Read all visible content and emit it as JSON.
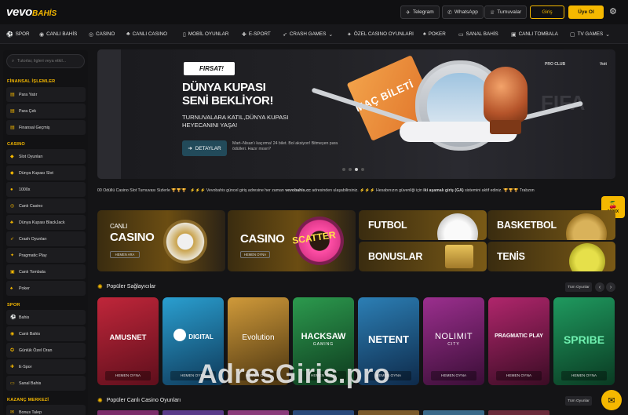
{
  "brand": {
    "name_main": "vevo",
    "name_accent": "BAHİS"
  },
  "topbar": {
    "links": [
      {
        "label": "Telegram",
        "icon": "telegram-icon"
      },
      {
        "label": "WhatsApp",
        "icon": "whatsapp-icon"
      },
      {
        "label": "Turnuvalar",
        "icon": "trophy-icon"
      }
    ],
    "login": "Giriş",
    "register": "Üye Ol"
  },
  "nav": [
    {
      "label": "SPOR",
      "icon": "ball-icon"
    },
    {
      "label": "CANLI BAHİS",
      "icon": "live-icon"
    },
    {
      "label": "CASINO",
      "icon": "chip-icon"
    },
    {
      "label": "CANLI CASINO",
      "icon": "cards-icon"
    },
    {
      "label": "MOBİL OYUNLAR",
      "icon": "mobile-icon"
    },
    {
      "label": "E-SPORT",
      "icon": "gamepad-icon"
    },
    {
      "label": "CRASH GAMES",
      "icon": "rocket-icon"
    },
    {
      "label": "ÖZEL CASINO OYUNLARI",
      "icon": "star-icon"
    },
    {
      "label": "POKER",
      "icon": "spade-icon"
    },
    {
      "label": "SANAL BAHİS",
      "icon": "monitor-icon"
    },
    {
      "label": "CANLI TOMBALA",
      "icon": "ticket-icon"
    },
    {
      "label": "TV GAMES",
      "icon": "tv-icon"
    }
  ],
  "sidebar": {
    "search_placeholder": "Tutorlar, ligleri veya etkil...",
    "sections": [
      {
        "title": "FİNANSAL İŞLEMLER",
        "items": [
          "Para Yatır",
          "Para Çek",
          "Finansal Geçmiş"
        ]
      },
      {
        "title": "CASINO",
        "items": [
          "Slot Oyunları",
          "Dünya Kupası Slot",
          "1000x",
          "Canlı Casino",
          "Dünya Kupası BlackJack",
          "Crash Oyunları",
          "Pragmatic Play",
          "Canlı Tombala",
          "Poker"
        ]
      },
      {
        "title": "SPOR",
        "items": [
          "Bahis",
          "Canlı Bahis",
          "Günlük Özel Oran",
          "E-Spor",
          "Sanal Bahis"
        ]
      },
      {
        "title": "KAZANÇ MERKEZİ",
        "items": [
          "Bonus Talep"
        ]
      }
    ]
  },
  "banner": {
    "badge": "FIRSAT!",
    "title_line1": "DÜNYA KUPASI",
    "title_line2": "SENİ BEKLİYOR!",
    "subtitle": "TURNUVALARA KATIL,DÜNYA KUPASI HEYECANINI YAŞA!",
    "button": "DETAYLAR",
    "note": "Mart–Nisan'ı kaçırma! 24 bilet. Bol aksiyon! Bitmeyen para ödülleri. Hazır mısın?",
    "ticket_text": "MAÇ BİLETİ",
    "bg_text": "FIFA",
    "sponsors": [
      "PRO CLUB",
      "Voit"
    ]
  },
  "ticker": {
    "text_a": "00 Ödüllü Casino Slot Turnuvası Sizlerle",
    "text_b": "Vevobahis güncel giriş adresine her zaman",
    "link": "vevobahis.cc",
    "text_c": "adresinden ulaşabilirsiniz.",
    "text_d": "Hesabınızın güvenliği için",
    "link2": "iki aşamalı giriş (GA)",
    "text_e": "sistemini aktif ediniz.",
    "text_f": "Trabzon"
  },
  "coin_badge": "1000X",
  "categories": [
    {
      "title_small": "CANLI",
      "title": "CASINO",
      "button": "HEMEN ARA"
    },
    {
      "title": "CASINO",
      "button": "HEMEN OYNA",
      "art": "SCATTER"
    },
    {
      "title": "FUTBOL"
    },
    {
      "title": "BASKETBOL"
    },
    {
      "title": "BONUSLAR"
    },
    {
      "title": "TENİS"
    }
  ],
  "providers_section": {
    "title": "Popüler Sağlayıcılar",
    "all_label": "Tüm Oyunlar"
  },
  "providers": [
    {
      "name": "AMUSNET",
      "button": "HEMEN OYNA",
      "color": "#c0263a"
    },
    {
      "name": "DIGITAL",
      "button": "HEMEN OYNA",
      "color": "#1f8fbf"
    },
    {
      "name": "Evolution",
      "button": "HEMEN OYNA",
      "color": "#c78a2a"
    },
    {
      "name": "HACKSAW",
      "sub": "GAMING",
      "button": "HEMEN OYNA",
      "color": "#2c9a4e"
    },
    {
      "name": "NETENT",
      "button": "HEMEN OYNA",
      "color": "#2c7fb5"
    },
    {
      "name": "NOLIMIT",
      "sub": "CITY",
      "button": "HEMEN OYNA",
      "color": "#9b2f8e"
    },
    {
      "name": "PRAGMATIC PLAY",
      "button": "HEMEN OYNA",
      "color": "#b0266c"
    },
    {
      "name": "SPRIBE",
      "button": "HEMEN OYNA",
      "color": "#1f9a5f"
    }
  ],
  "live_section": {
    "title": "Popüler Canlı Casino Oyunları",
    "all_label": "Tüm Oyunlar"
  },
  "watermark": "AdresGiris.pro"
}
